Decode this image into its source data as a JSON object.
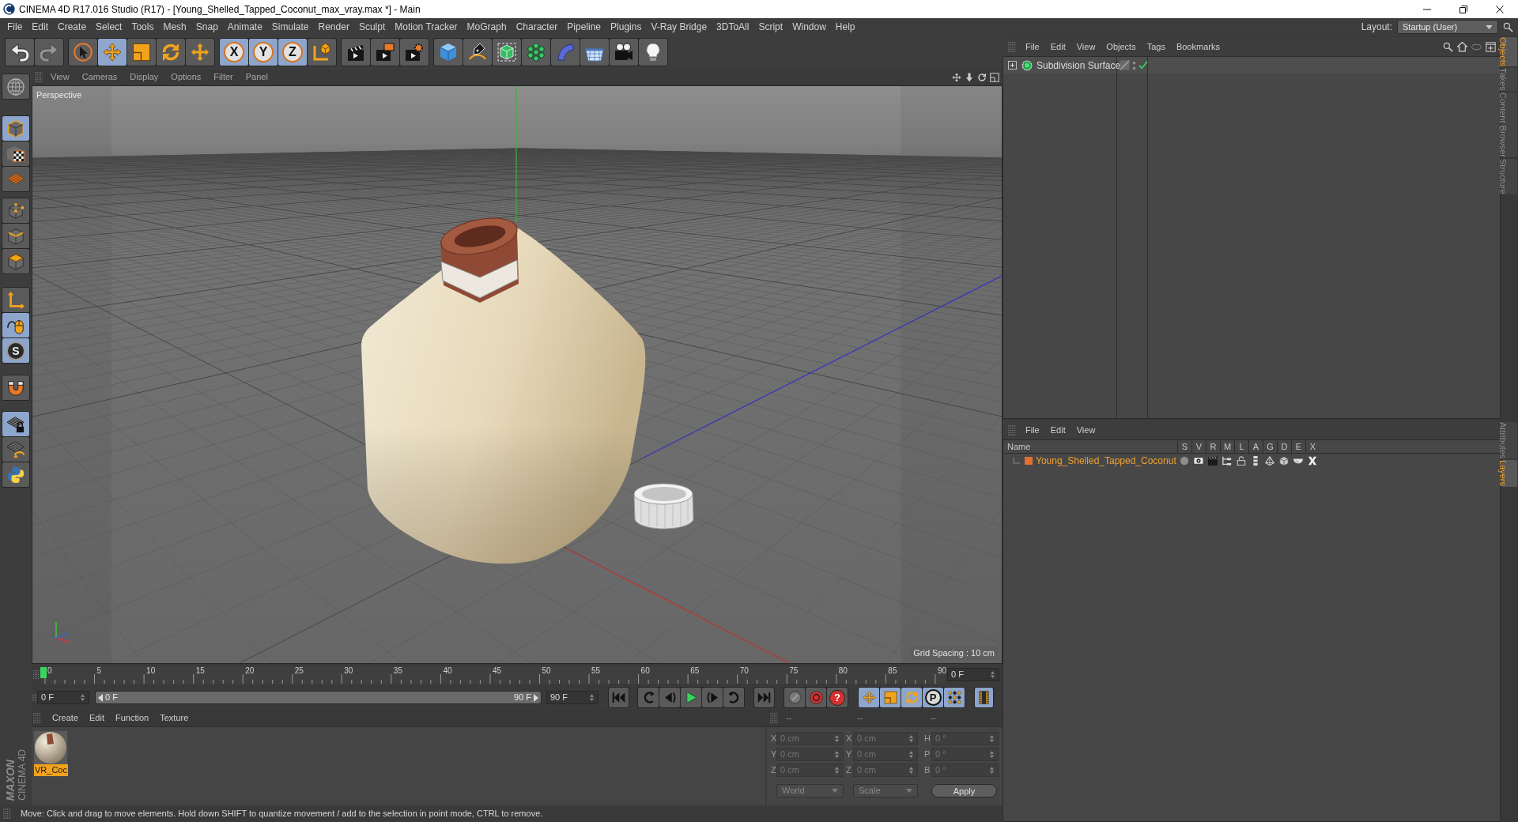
{
  "window": {
    "title": "CINEMA 4D R17.016 Studio (R17) - [Young_Shelled_Tapped_Coconut_max_vray.max *] - Main"
  },
  "menu_bar": {
    "items": [
      "File",
      "Edit",
      "Create",
      "Select",
      "Tools",
      "Mesh",
      "Snap",
      "Animate",
      "Simulate",
      "Render",
      "Sculpt",
      "Motion Tracker",
      "MoGraph",
      "Character",
      "Pipeline",
      "Plugins",
      "V-Ray Bridge",
      "3DToAll",
      "Script",
      "Window",
      "Help"
    ],
    "layout_label": "Layout:",
    "layout_value": "Startup (User)"
  },
  "toolbar": [
    {
      "selected": false,
      "disabled": false
    },
    {
      "selected": false,
      "disabled": true
    },
    {
      "selected": false,
      "disabled": false
    },
    {
      "selected": true,
      "disabled": false
    },
    {
      "selected": false,
      "disabled": false
    },
    {
      "selected": false,
      "disabled": false
    },
    {
      "selected": false,
      "disabled": false
    },
    {
      "label": "X",
      "selected": true,
      "disabled": false
    },
    {
      "label": "Y",
      "selected": true,
      "disabled": false
    },
    {
      "label": "Z",
      "selected": true,
      "disabled": false
    },
    {
      "selected": false,
      "disabled": false
    },
    {
      "selected": false,
      "disabled": false
    },
    {
      "selected": false,
      "disabled": false
    },
    {
      "selected": false,
      "disabled": false
    },
    {
      "selected": false,
      "disabled": false
    },
    {
      "selected": false,
      "disabled": false
    },
    {
      "selected": false,
      "disabled": false
    },
    {
      "selected": false,
      "disabled": false
    },
    {
      "selected": false,
      "disabled": false
    },
    {
      "selected": false,
      "disabled": false
    },
    {
      "selected": false,
      "disabled": false
    },
    {
      "selected": false,
      "disabled": false
    }
  ],
  "left_toolbar": [
    {
      "selected": false
    },
    {
      "selected": true
    },
    {
      "selected": false
    },
    {
      "selected": false
    },
    {
      "selected": false
    },
    {
      "selected": false
    },
    {
      "selected": false
    },
    {
      "selected": false
    },
    {
      "selected": true
    },
    {
      "label": "S",
      "selected": true
    },
    {
      "selected": false
    },
    {
      "selected": true
    },
    {
      "selected": false
    },
    {
      "selected": false
    }
  ],
  "viewport": {
    "menu": [
      "View",
      "Cameras",
      "Display",
      "Options",
      "Filter",
      "Panel"
    ],
    "camera": "Perspective",
    "grid_spacing": "Grid Spacing : 10 cm"
  },
  "timeline": {
    "labels": [
      "0",
      "5",
      "10",
      "15",
      "20",
      "25",
      "30",
      "35",
      "40",
      "45",
      "50",
      "55",
      "60",
      "65",
      "70",
      "75",
      "80",
      "85",
      "90"
    ],
    "level": 0,
    "current_frame": "0 F"
  },
  "transport": {
    "start_field": "0 F",
    "range": {
      "start": "0 F",
      "end": "90 F",
      "level": 1
    },
    "end_field": "90 F",
    "buttons": [
      {
        "selected": false
      },
      {
        "selected": false
      },
      {
        "selected": false
      },
      {
        "selected": false
      },
      {
        "selected": false
      },
      {
        "selected": false
      },
      {
        "selected": false
      },
      {
        "selected": false
      },
      {
        "selected": false
      },
      {
        "label": "?",
        "selected": false
      },
      {
        "selected": true
      },
      {
        "selected": true
      },
      {
        "selected": true
      },
      {
        "label": "P",
        "selected": true
      },
      {
        "selected": true
      },
      {
        "selected": true
      }
    ]
  },
  "material_manager": {
    "menu": [
      "Create",
      "Edit",
      "Function",
      "Texture"
    ],
    "materials": [
      {
        "name": "VR_Coc",
        "selected": true
      }
    ]
  },
  "coordinates": {
    "headers": [
      "--",
      "--",
      "--"
    ],
    "rows": [
      {
        "position_axis": "X",
        "position": "0 cm",
        "size_axis": "X",
        "size": "0 cm",
        "rotation_axis": "H",
        "rotation": "0 °"
      },
      {
        "position_axis": "Y",
        "position": "0 cm",
        "size_axis": "Y",
        "size": "0 cm",
        "rotation_axis": "P",
        "rotation": "0 °"
      },
      {
        "position_axis": "Z",
        "position": "0 cm",
        "size_axis": "Z",
        "size": "0 cm",
        "rotation_axis": "B",
        "rotation": "0 °"
      }
    ],
    "position_mode": "World",
    "size_mode": "Scale",
    "apply": "Apply"
  },
  "status_bar": {
    "text": "Move: Click and drag to move elements. Hold down SHIFT to quantize movement / add to the selection in point mode, CTRL to remove."
  },
  "object_manager": {
    "menu": [
      "File",
      "Edit",
      "View",
      "Objects",
      "Tags",
      "Bookmarks"
    ],
    "objects": [
      {
        "name": "Subdivision Surface",
        "expanded": false,
        "enabled": true
      }
    ]
  },
  "layer_manager": {
    "menu": [
      "File",
      "Edit",
      "View"
    ],
    "columns": [
      "Name",
      "S",
      "V",
      "R",
      "M",
      "L",
      "A",
      "G",
      "D",
      "E",
      "X"
    ],
    "layers": [
      {
        "name": "Young_Shelled_Tapped_Coconut",
        "color": "#e0702e",
        "selected": true
      }
    ]
  },
  "side_tabs_upper": [
    {
      "label": "Objects",
      "selected": true
    },
    {
      "label": "Takes",
      "selected": false
    },
    {
      "label": "Content Browser",
      "selected": false
    },
    {
      "label": "Structure",
      "selected": false
    }
  ],
  "side_tabs_lower": [
    {
      "label": "Attributes",
      "selected": false
    },
    {
      "label": "Layers",
      "selected": true
    }
  ],
  "logo": {
    "brand": "MAXON",
    "product": "CINEMA 4D"
  }
}
